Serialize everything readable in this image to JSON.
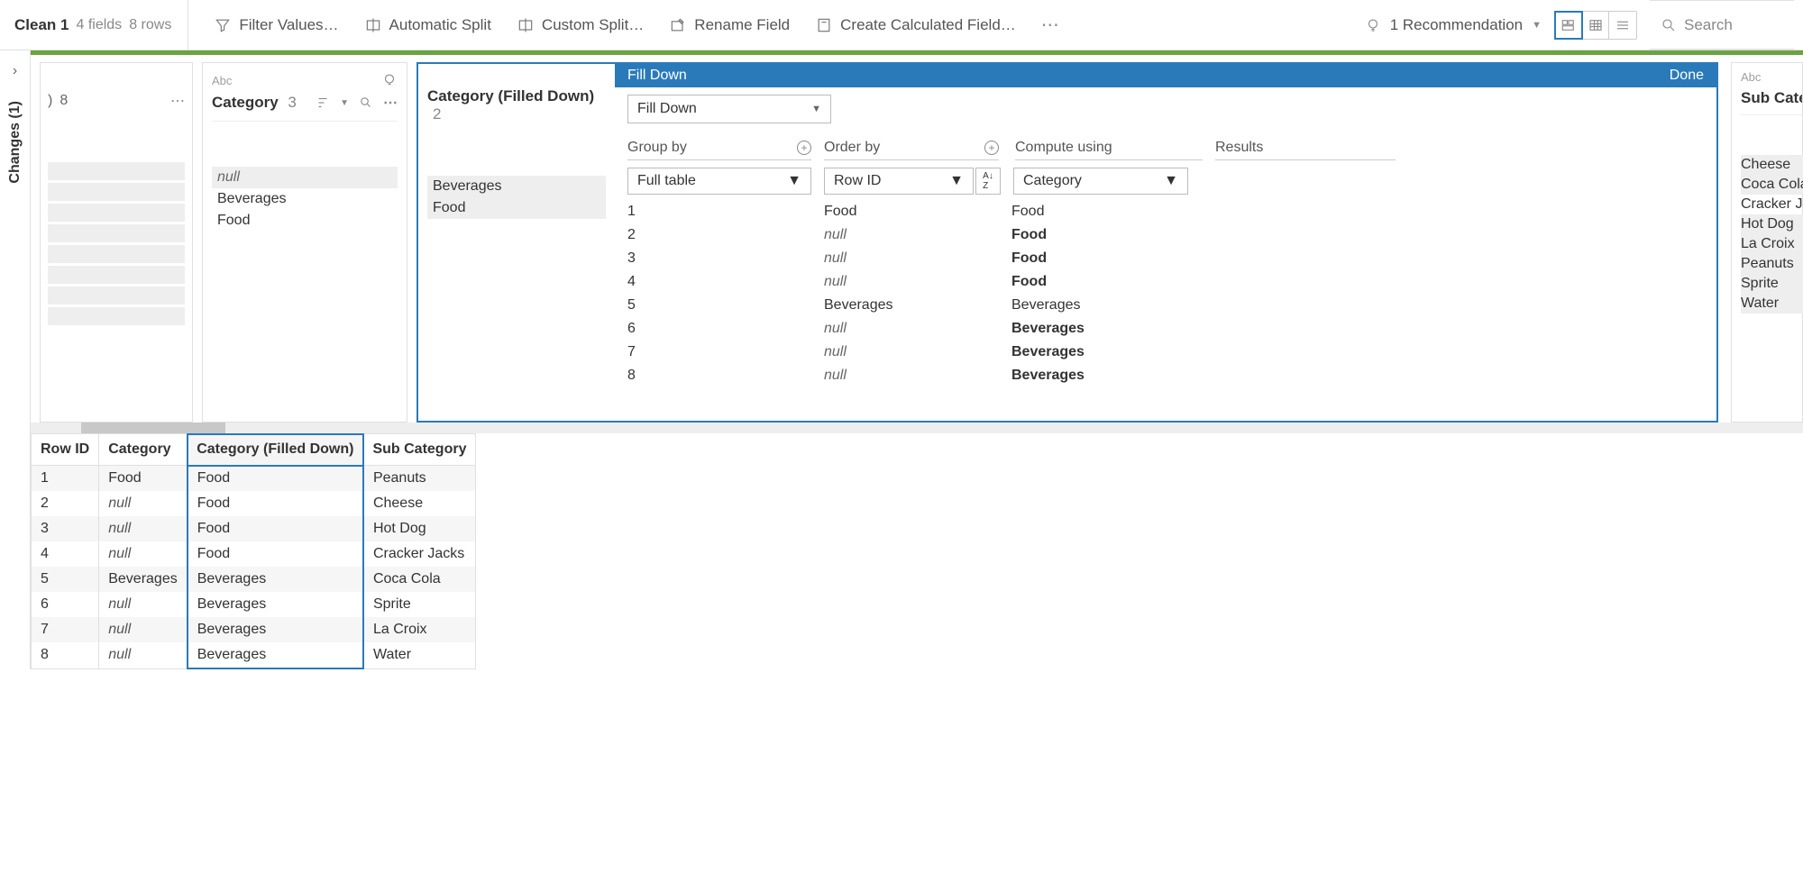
{
  "toolbar": {
    "step_name": "Clean 1",
    "fields_label": "4 fields",
    "rows_label": "8 rows",
    "filter_values": "Filter Values…",
    "automatic_split": "Automatic Split",
    "custom_split": "Custom Split…",
    "rename_field": "Rename Field",
    "create_calc": "Create Calculated Field…",
    "recommendation": "1 Recommendation",
    "search_placeholder": "Search"
  },
  "changes_panel": {
    "label": "Changes (1)"
  },
  "partial_card": {
    "summary_count": "8"
  },
  "category_card": {
    "type_label": "Abc",
    "field_name": "Category",
    "distinct": "3",
    "values": [
      {
        "text": "null",
        "is_null": true,
        "shaded": true
      },
      {
        "text": "Beverages",
        "is_null": false,
        "shaded": false
      },
      {
        "text": "Food",
        "is_null": false,
        "shaded": false
      }
    ]
  },
  "filldown": {
    "panel_title": "Fill Down",
    "done_label": "Done",
    "left_field_name": "Category (Filled Down)",
    "left_distinct": "2",
    "left_values": [
      {
        "text": "Beverages",
        "shaded": true
      },
      {
        "text": "Food",
        "shaded": true
      }
    ],
    "dropdown_value": "Fill Down",
    "col_groupby": "Group by",
    "col_orderby": "Order by",
    "col_compute": "Compute using",
    "col_results": "Results",
    "groupby_value": "Full table",
    "orderby_value": "Row ID",
    "compute_value": "Category",
    "rows": [
      {
        "idx": "1",
        "compute": "Food",
        "compute_null": false,
        "result": "Food",
        "result_bold": false
      },
      {
        "idx": "2",
        "compute": "null",
        "compute_null": true,
        "result": "Food",
        "result_bold": true
      },
      {
        "idx": "3",
        "compute": "null",
        "compute_null": true,
        "result": "Food",
        "result_bold": true
      },
      {
        "idx": "4",
        "compute": "null",
        "compute_null": true,
        "result": "Food",
        "result_bold": true
      },
      {
        "idx": "5",
        "compute": "Beverages",
        "compute_null": false,
        "result": "Beverages",
        "result_bold": false
      },
      {
        "idx": "6",
        "compute": "null",
        "compute_null": true,
        "result": "Beverages",
        "result_bold": true
      },
      {
        "idx": "7",
        "compute": "null",
        "compute_null": true,
        "result": "Beverages",
        "result_bold": true
      },
      {
        "idx": "8",
        "compute": "null",
        "compute_null": true,
        "result": "Beverages",
        "result_bold": true
      }
    ]
  },
  "subcat_card": {
    "type_label": "Abc",
    "field_name": "Sub Catego",
    "values": [
      {
        "text": "Cheese",
        "shaded": true
      },
      {
        "text": "Coca Cola",
        "shaded": true
      },
      {
        "text": "Cracker Ja",
        "shaded": false
      },
      {
        "text": "Hot Dog",
        "shaded": true
      },
      {
        "text": "La Croix",
        "shaded": true
      },
      {
        "text": "Peanuts",
        "shaded": true
      },
      {
        "text": "Sprite",
        "shaded": true
      },
      {
        "text": "Water",
        "shaded": true
      }
    ]
  },
  "grid": {
    "headers": [
      "Row ID",
      "Category",
      "Category (Filled Down)",
      "Sub Category"
    ],
    "selected_col_index": 2,
    "rows": [
      {
        "cells": [
          "1",
          "Food",
          "Food",
          "Peanuts"
        ],
        "nulls": [
          false,
          false,
          false,
          false
        ]
      },
      {
        "cells": [
          "2",
          "null",
          "Food",
          "Cheese"
        ],
        "nulls": [
          false,
          true,
          false,
          false
        ]
      },
      {
        "cells": [
          "3",
          "null",
          "Food",
          "Hot Dog"
        ],
        "nulls": [
          false,
          true,
          false,
          false
        ]
      },
      {
        "cells": [
          "4",
          "null",
          "Food",
          "Cracker Jacks"
        ],
        "nulls": [
          false,
          true,
          false,
          false
        ]
      },
      {
        "cells": [
          "5",
          "Beverages",
          "Beverages",
          "Coca Cola"
        ],
        "nulls": [
          false,
          false,
          false,
          false
        ]
      },
      {
        "cells": [
          "6",
          "null",
          "Beverages",
          "Sprite"
        ],
        "nulls": [
          false,
          true,
          false,
          false
        ]
      },
      {
        "cells": [
          "7",
          "null",
          "Beverages",
          "La Croix"
        ],
        "nulls": [
          false,
          true,
          false,
          false
        ]
      },
      {
        "cells": [
          "8",
          "null",
          "Beverages",
          "Water"
        ],
        "nulls": [
          false,
          true,
          false,
          false
        ]
      }
    ]
  }
}
